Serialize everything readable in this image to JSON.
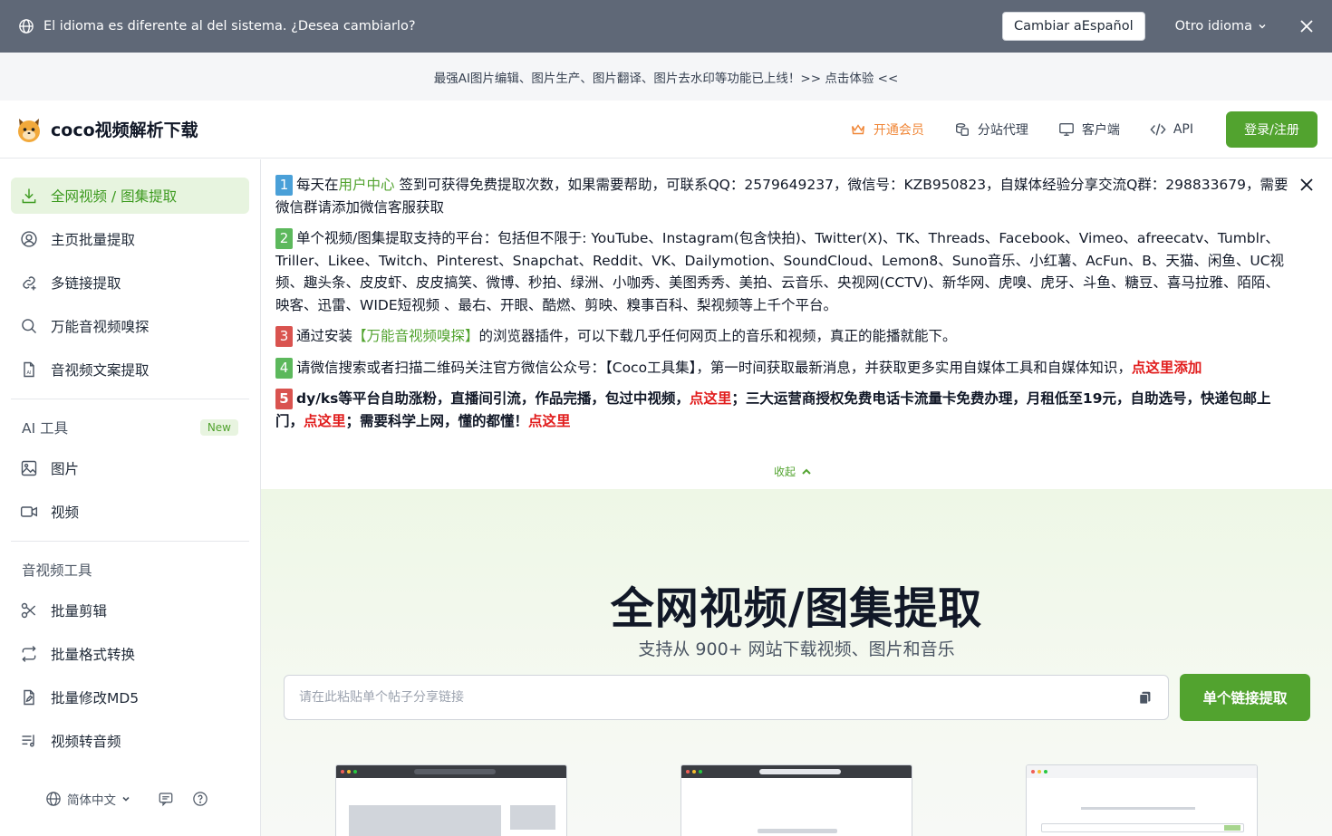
{
  "language_bar": {
    "message": "El idioma es diferente al del sistema. ¿Desea cambiarlo?",
    "switch_label": "Cambiar aEspañol",
    "other_label": "Otro idioma"
  },
  "promo": {
    "text": "最强AI图片编辑、图片生产、图片翻译、图片去水印等功能已上线！>> 点击体验 <<"
  },
  "header": {
    "brand": "coco视频解析下载",
    "nav": [
      {
        "label": "开通会员",
        "icon": "crown-icon"
      },
      {
        "label": "分站代理",
        "icon": "coins-icon"
      },
      {
        "label": "客户端",
        "icon": "monitor-icon"
      },
      {
        "label": "API",
        "icon": "code-icon"
      }
    ],
    "login_label": "登录/注册",
    "accent_color": "#52a32f",
    "vip_color": "#f0883a"
  },
  "sidebar": {
    "main_items": [
      {
        "label": "全网视频 / 图集提取",
        "icon": "download-icon",
        "active": true
      },
      {
        "label": "主页批量提取",
        "icon": "user-circle-icon"
      },
      {
        "label": "多链接提取",
        "icon": "link-plus-icon"
      },
      {
        "label": "万能音视频嗅探",
        "icon": "search-icon"
      },
      {
        "label": "音视频文案提取",
        "icon": "document-ai-icon"
      }
    ],
    "ai_section": {
      "title": "AI 工具",
      "badge": "New"
    },
    "ai_items": [
      {
        "label": "图片",
        "icon": "image-icon"
      },
      {
        "label": "视频",
        "icon": "video-icon"
      }
    ],
    "media_section": {
      "title": "音视频工具"
    },
    "media_items": [
      {
        "label": "批量剪辑",
        "icon": "scissors-icon"
      },
      {
        "label": "批量格式转换",
        "icon": "convert-icon"
      },
      {
        "label": "批量修改MD5",
        "icon": "file-edit-icon"
      },
      {
        "label": "视频转音频",
        "icon": "audio-list-icon"
      }
    ],
    "footer": {
      "language": "简体中文"
    }
  },
  "notice": {
    "items": [
      {
        "num": "1",
        "pre": "每天在",
        "link": "用户中心",
        "post": " 签到可获得免费提取次数，如果需要帮助，可联系QQ：2579649237，微信号：KZB950823，自媒体经验分享交流Q群：298833679，需要微信群请添加微信客服获取"
      },
      {
        "num": "2",
        "text": "单个视频/图集提取支持的平台：包括但不限于: YouTube、Instagram(包含快拍)、Twitter(X)、TK、Threads、Facebook、Vimeo、afreecatv、Tumblr、Triller、Likee、Twitch、Pinterest、Snapchat、Reddit、VK、Dailymotion、SoundCloud、Lemon8、Suno音乐、小红薯、AcFun、B、天猫、闲鱼、UC视频、趣头条、皮皮虾、皮皮搞笑、微博、秒拍、绿洲、小咖秀、美图秀秀、美拍、云音乐、央视网(CCTV)、新华网、虎嗅、虎牙、斗鱼、糖豆、喜马拉雅、陌陌、映客、迅雷、WIDE短视频 、最右、开眼、酷燃、剪映、糗事百科、梨视频等上千个平台。"
      },
      {
        "num": "3",
        "pre": "通过安装",
        "link": "【万能音视频嗅探】",
        "post": "的浏览器插件，可以下载几乎任何网页上的音乐和视频，真正的能播就能下。"
      },
      {
        "num": "4",
        "text": "请微信搜索或者扫描二维码关注官方微信公众号：【Coco工具集】，第一时间获取最新消息，并获取更多实用自媒体工具和自媒体知识，",
        "link": "点这里添加"
      },
      {
        "num": "5",
        "t1": "dy/ks等平台自助涨粉，直播间引流，作品完播，包过中视频，",
        "l1": "点这里",
        "t2": "；三大运营商授权免费电话卡流量卡免费办理，月租低至19元，自助选号，快递包邮上门，",
        "l2": "点这里",
        "t3": "；需要科学上网，懂的都懂！",
        "l3": "点这里"
      }
    ],
    "collapse_label": "收起"
  },
  "hero": {
    "title": "全网视频/图集提取",
    "subtitle": "支持从 900+ 网站下载视频、图片和音乐",
    "input_placeholder": "请在此粘贴单个帖子分享链接",
    "button_label": "单个链接提取"
  }
}
